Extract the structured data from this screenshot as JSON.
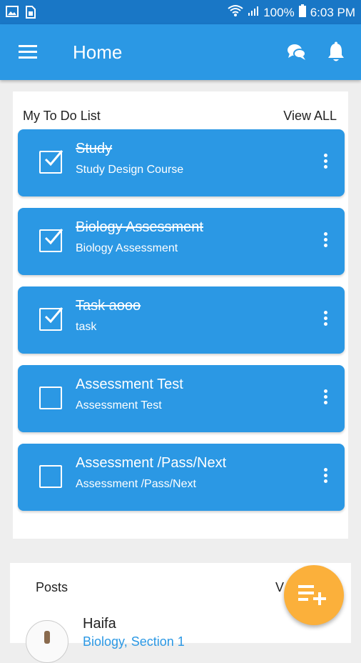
{
  "status": {
    "battery": "100%",
    "time": "6:03 PM"
  },
  "appbar": {
    "title": "Home"
  },
  "todo": {
    "heading": "My To Do List",
    "view_all": "View ALL",
    "tasks": [
      {
        "title": "Study",
        "subtitle": "Study Design Course",
        "done": true
      },
      {
        "title": "Biology Assessment",
        "subtitle": "Biology Assessment",
        "done": true
      },
      {
        "title": "Task aooo",
        "subtitle": "task",
        "done": true
      },
      {
        "title": "Assessment Test",
        "subtitle": "Assessment Test",
        "done": false
      },
      {
        "title": "Assessment /Pass/Next",
        "subtitle": "Assessment /Pass/Next",
        "done": false
      }
    ]
  },
  "posts": {
    "heading": "Posts",
    "view_all_partial": "V",
    "items": [
      {
        "author": "Haifa",
        "subtitle": "Biology, Section 1"
      }
    ]
  },
  "colors": {
    "primary": "#2b98e4",
    "status_bar": "#1977c6",
    "fab": "#fbb03b"
  },
  "icons": [
    "gallery-icon",
    "sim-icon",
    "wifi-icon",
    "signal-icon",
    "battery-icon",
    "menu-icon",
    "chat-icon",
    "bell-icon",
    "checkbox-checked-icon",
    "checkbox-empty-icon",
    "more-vert-icon",
    "add-playlist-icon"
  ]
}
